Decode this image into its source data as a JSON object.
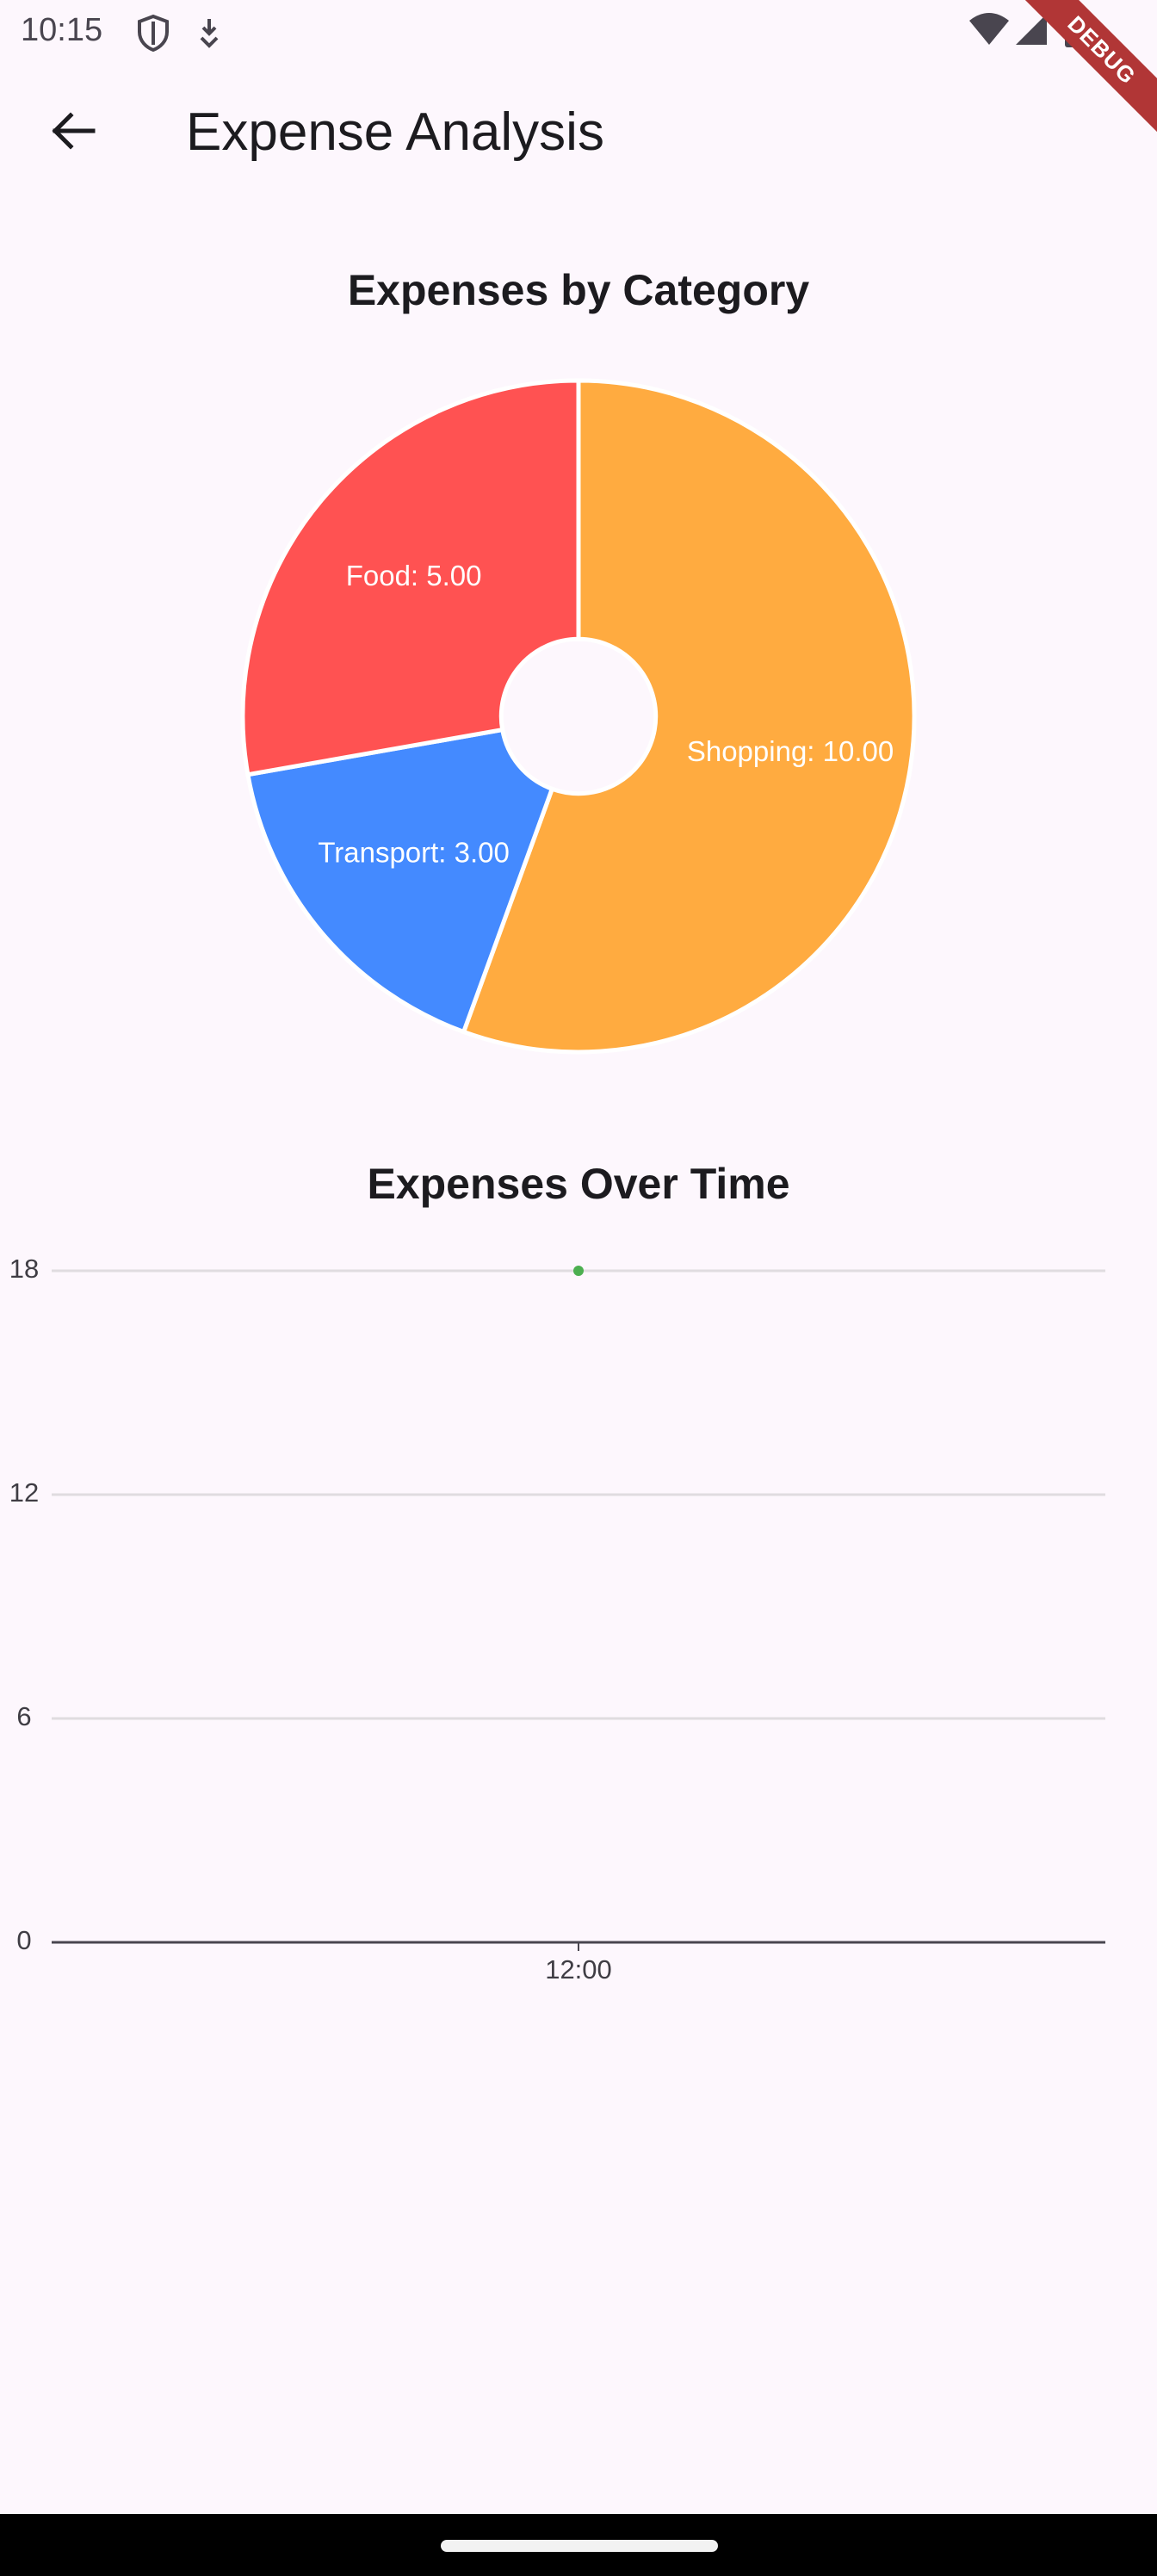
{
  "status_bar": {
    "time": "10:15",
    "icons": [
      "shield-icon",
      "download-status-icon",
      "wifi-icon",
      "signal-icon",
      "battery-icon"
    ]
  },
  "app_bar": {
    "title": "Expense Analysis",
    "back_icon": "arrow-back-icon"
  },
  "debug_banner": {
    "label": "DEBUG"
  },
  "pie_section": {
    "title": "Expenses by Category"
  },
  "line_section": {
    "title": "Expenses Over Time"
  },
  "colors": {
    "background": "#fdf7fd",
    "food": "#ff5252",
    "transport": "#448aff",
    "shopping": "#ffab40",
    "line_point": "#4caf50",
    "grid": "#e0dce0",
    "axis": "#49454f"
  },
  "chart_data": [
    {
      "type": "pie",
      "title": "Expenses by Category",
      "hole_ratio": 0.23,
      "slices": [
        {
          "label": "Food: 5.00",
          "name": "Food",
          "value": 5.0,
          "color": "#ff5252"
        },
        {
          "label": "Shopping: 10.00",
          "name": "Shopping",
          "value": 10.0,
          "color": "#ffab40"
        },
        {
          "label": "Transport: 3.00",
          "name": "Transport",
          "value": 3.0,
          "color": "#448aff"
        }
      ]
    },
    {
      "type": "scatter",
      "title": "Expenses Over Time",
      "x_tick_labels": [
        "12:00"
      ],
      "y_ticks": [
        0,
        6,
        12,
        18
      ],
      "ylim": [
        0,
        18
      ],
      "grid": true,
      "series": [
        {
          "points": [
            {
              "x": "12:00",
              "y": 18
            }
          ],
          "color": "#4caf50"
        }
      ]
    }
  ]
}
